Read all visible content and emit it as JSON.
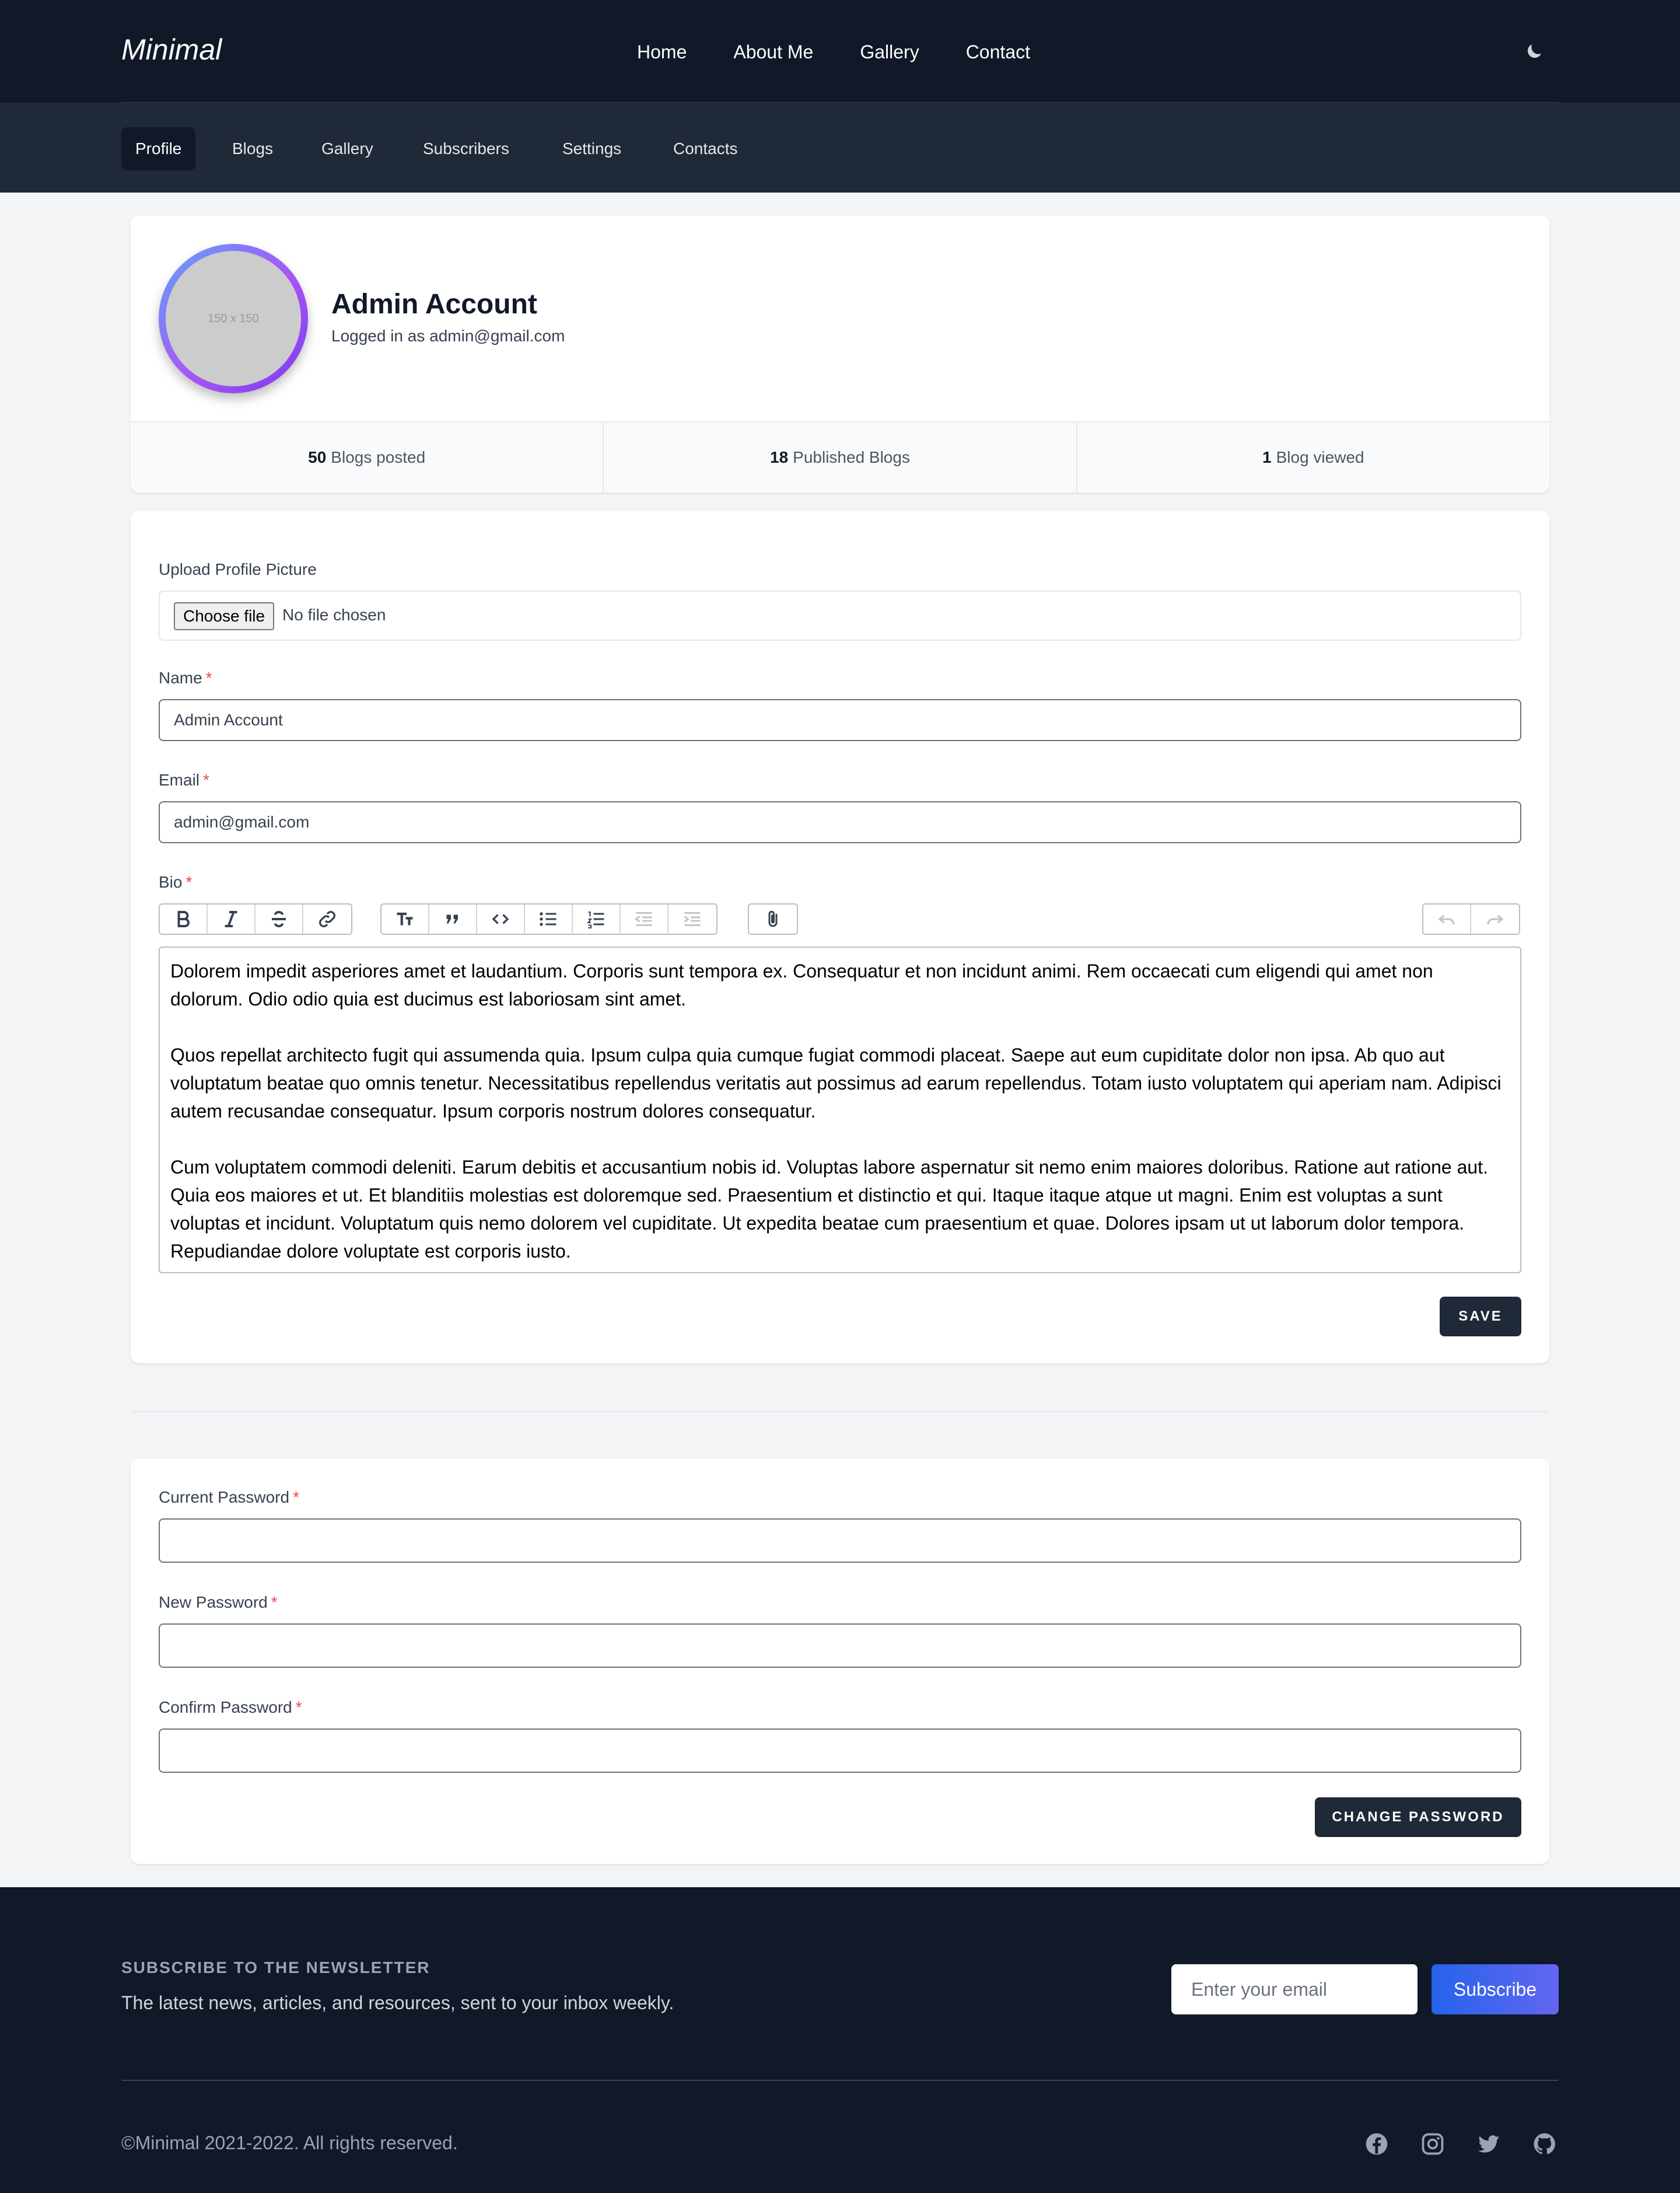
{
  "header": {
    "brand": "Minimal",
    "menu": [
      "Home",
      "About Me",
      "Gallery",
      "Contact"
    ],
    "theme_toggle_icon": "moon-icon"
  },
  "subnav": {
    "tabs": [
      "Profile",
      "Blogs",
      "Gallery",
      "Subscribers",
      "Settings",
      "Contacts"
    ],
    "active": "Profile"
  },
  "profile": {
    "avatar_placeholder": "150 x 150",
    "name": "Admin Account",
    "logged_in_text": "Logged in as admin@gmail.com",
    "stats": [
      {
        "count": "50",
        "label": "Blogs posted"
      },
      {
        "count": "18",
        "label": "Published Blogs"
      },
      {
        "count": "1",
        "label": "Blog viewed"
      }
    ]
  },
  "profile_form": {
    "upload_label": "Upload Profile Picture",
    "file_button": "Choose file",
    "file_status": "No file chosen",
    "name_label": "Name",
    "name_value": "Admin Account",
    "email_label": "Email",
    "email_value": "admin@gmail.com",
    "bio_label": "Bio",
    "required_mark": "*",
    "toolbar_icons": [
      "bold-icon",
      "italic-icon",
      "strikethrough-icon",
      "link-icon",
      "heading-icon",
      "quote-icon",
      "code-icon",
      "bullet-list-icon",
      "numbered-list-icon",
      "decrease-indent-icon",
      "increase-indent-icon",
      "attach-icon",
      "undo-icon",
      "redo-icon"
    ],
    "bio_paragraphs": [
      "Dolorem impedit asperiores amet et laudantium. Corporis sunt tempora ex. Consequatur et non incidunt animi. Rem occaecati cum eligendi qui amet non dolorum. Odio odio quia est ducimus est laboriosam sint amet.",
      "Quos repellat architecto fugit qui assumenda quia. Ipsum culpa quia cumque fugiat commodi placeat. Saepe aut eum cupiditate dolor non ipsa. Ab quo aut voluptatum beatae quo omnis tenetur. Necessitatibus repellendus veritatis aut possimus ad earum repellendus. Totam iusto voluptatem qui aperiam nam. Adipisci autem recusandae consequatur. Ipsum corporis nostrum dolores consequatur.",
      "Cum voluptatem commodi deleniti. Earum debitis et accusantium nobis id. Voluptas labore aspernatur sit nemo enim maiores doloribus. Ratione aut ratione aut. Quia eos maiores et ut. Et blanditiis molestias est doloremque sed. Praesentium et distinctio et qui. Itaque itaque atque ut magni. Enim est voluptas a sunt voluptas et incidunt. Voluptatum quis nemo dolorem vel cupiditate. Ut expedita beatae cum praesentium et quae. Dolores ipsam ut ut laborum dolor tempora. Repudiandae dolore voluptate est corporis iusto."
    ],
    "save_label": "SAVE"
  },
  "password_form": {
    "current_label": "Current Password",
    "new_label": "New Password",
    "confirm_label": "Confirm Password",
    "submit_label": "CHANGE PASSWORD"
  },
  "footer": {
    "newsletter_title": "SUBSCRIBE TO THE NEWSLETTER",
    "newsletter_desc": "The latest news, articles, and resources, sent to your inbox weekly.",
    "email_placeholder": "Enter your email",
    "subscribe_label": "Subscribe",
    "copyright": "©Minimal 2021-2022. All rights reserved.",
    "social_icons": [
      "facebook-icon",
      "instagram-icon",
      "twitter-icon",
      "github-icon"
    ]
  },
  "colors": {
    "nav_bg": "#111827",
    "subnav_bg": "#1f2937",
    "page_bg": "#f3f4f6",
    "accent": "#2563eb",
    "required": "#ef4444"
  }
}
